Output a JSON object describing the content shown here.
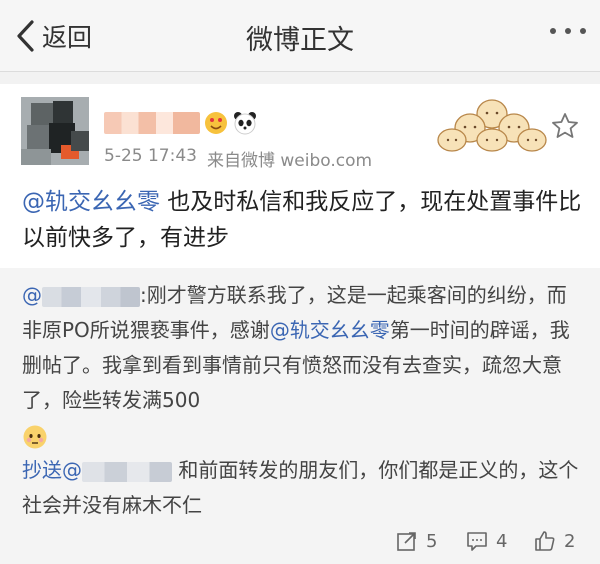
{
  "nav": {
    "back_label": "返回",
    "title": "微博正文"
  },
  "post": {
    "username_hidden": true,
    "time": "5-25 17:43",
    "source": "来自微博 weibo.com",
    "mention": "@轨交幺幺零",
    "text_after_mention": " 也及时私信和我反应了，现在处置事件比以前快多了，有进步"
  },
  "repost": {
    "line1_prefix": "@",
    "line1_after": ":刚才警方联系我了，这是一起乘客间的纠纷，而非原PO所说猥亵事件，感谢",
    "mention": "@轨交幺幺零",
    "line2": "第一时间的辟谣，我删帖了。我拿到看到事情前只有愤怒而没有去查实，疏忽大意了，险些转发满500",
    "cc_prefix": "抄送@",
    "cc_after": " 和前面转发的朋友们，你们都是正义的，这个社会并没有麻木不仁"
  },
  "actions": {
    "repost_count": "5",
    "comment_count": "4",
    "like_count": "2"
  },
  "colors": {
    "link": "#3b66b3",
    "meta": "#8a8a8a"
  }
}
